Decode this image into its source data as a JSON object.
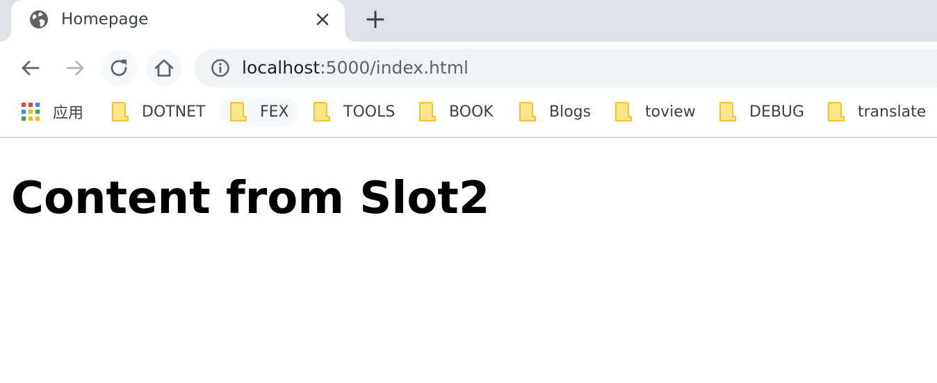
{
  "browser": {
    "tab": {
      "title": "Homepage",
      "favicon": "globe-icon",
      "close_icon": "close-icon"
    },
    "new_tab_icon": "plus-icon",
    "toolbar": {
      "back_icon": "arrow-left-icon",
      "forward_icon": "arrow-right-icon",
      "reload_icon": "reload-icon",
      "home_icon": "home-icon"
    },
    "omnibox": {
      "info_icon": "info-icon",
      "url_host": "localhost",
      "url_rest": ":5000/index.html"
    },
    "bookmarks": [
      {
        "label": "应用",
        "icon": "apps-grid-icon"
      },
      {
        "label": "DOTNET",
        "icon": "folder-icon"
      },
      {
        "label": "FEX",
        "icon": "folder-icon"
      },
      {
        "label": "TOOLS",
        "icon": "folder-icon"
      },
      {
        "label": "BOOK",
        "icon": "folder-icon"
      },
      {
        "label": "Blogs",
        "icon": "folder-icon"
      },
      {
        "label": "toview",
        "icon": "folder-icon"
      },
      {
        "label": "DEBUG",
        "icon": "folder-icon"
      },
      {
        "label": "translate",
        "icon": "folder-icon"
      }
    ]
  },
  "page": {
    "heading": "Content from Slot2"
  },
  "colors": {
    "tabstrip": "#dee1e6",
    "omnibox": "#f1f3f4",
    "folder_fill": "#fde68a",
    "folder_stroke": "#f0c332",
    "icon_gray": "#5f6368"
  }
}
